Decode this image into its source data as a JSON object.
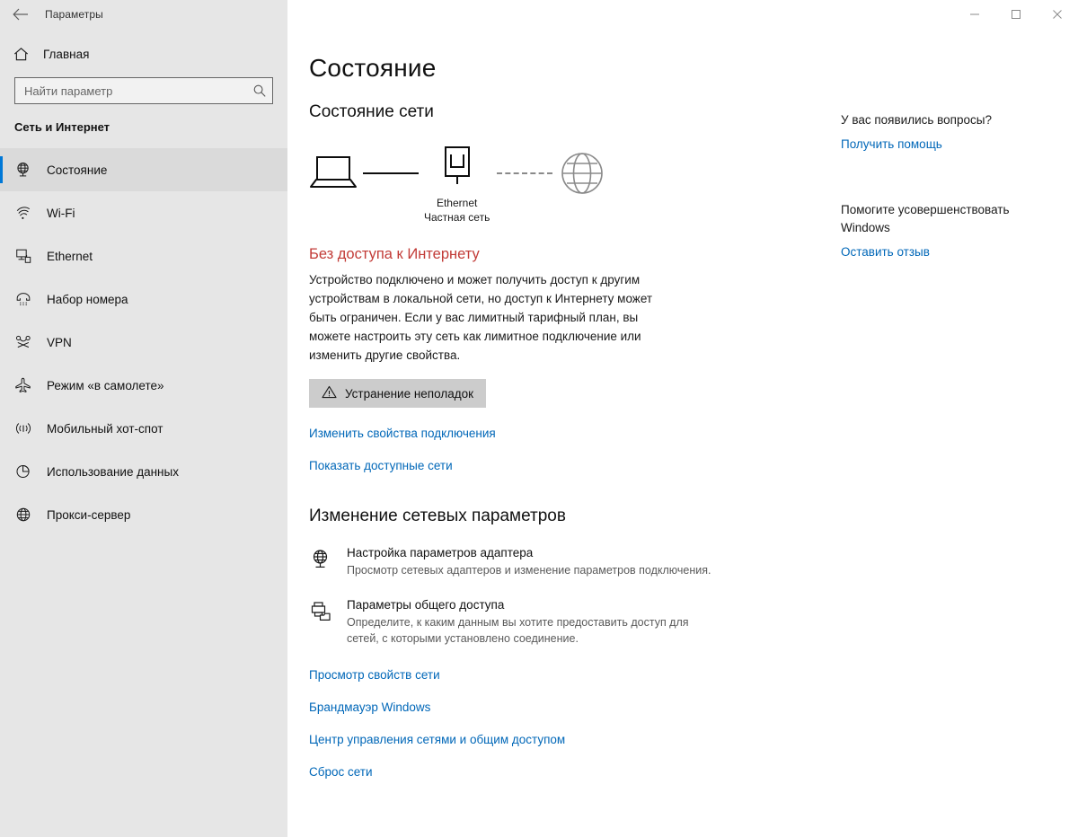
{
  "titlebar": {
    "back_icon": "back-arrow-icon",
    "title": "Параметры",
    "minimize_icon": "minimize-icon",
    "maximize_icon": "maximize-icon",
    "close_icon": "close-icon"
  },
  "sidebar": {
    "home": {
      "icon": "home-icon",
      "label": "Главная"
    },
    "search": {
      "icon": "search-icon",
      "placeholder": "Найти параметр",
      "value": ""
    },
    "section_title": "Сеть и Интернет",
    "items": [
      {
        "icon": "globe-monitor-icon",
        "label": "Состояние",
        "selected": true
      },
      {
        "icon": "wifi-icon",
        "label": "Wi-Fi",
        "selected": false
      },
      {
        "icon": "ethernet-icon",
        "label": "Ethernet",
        "selected": false
      },
      {
        "icon": "dialup-icon",
        "label": "Набор номера",
        "selected": false
      },
      {
        "icon": "vpn-icon",
        "label": "VPN",
        "selected": false
      },
      {
        "icon": "airplane-icon",
        "label": "Режим «в самолете»",
        "selected": false
      },
      {
        "icon": "hotspot-icon",
        "label": "Мобильный хот-спот",
        "selected": false
      },
      {
        "icon": "data-usage-icon",
        "label": "Использование данных",
        "selected": false
      },
      {
        "icon": "proxy-globe-icon",
        "label": "Прокси-сервер",
        "selected": false
      }
    ]
  },
  "main": {
    "page_title": "Состояние",
    "network_status_heading": "Состояние сети",
    "diagram": {
      "device_icon": "laptop-icon",
      "adapter_icon": "ethernet-port-icon",
      "adapter_name": "Ethernet",
      "adapter_network_type": "Частная сеть",
      "internet_icon": "globe-icon",
      "device_to_adapter_link": "connected",
      "adapter_to_internet_link": "disconnected"
    },
    "status_heading": "Без доступа к Интернету",
    "status_description": "Устройство подключено и может получить доступ к другим устройствам в локальной сети, но доступ к Интернету может быть ограничен. Если у вас лимитный тарифный план, вы можете настроить эту сеть как лимитное подключение или изменить другие свойства.",
    "troubleshoot_button": {
      "icon": "warning-triangle-icon",
      "label": "Устранение неполадок"
    },
    "links_top": [
      "Изменить свойства подключения",
      "Показать доступные сети"
    ],
    "change_settings_heading": "Изменение сетевых параметров",
    "settings": [
      {
        "icon": "adapter-globe-icon",
        "title": "Настройка параметров адаптера",
        "subtitle": "Просмотр сетевых адаптеров и изменение параметров подключения."
      },
      {
        "icon": "sharing-printer-folder-icon",
        "title": "Параметры общего доступа",
        "subtitle": "Определите, к каким данным вы хотите предоставить доступ для сетей, с которыми установлено соединение."
      }
    ],
    "links_bottom": [
      "Просмотр свойств сети",
      "Брандмауэр Windows",
      "Центр управления сетями и общим доступом",
      "Сброс сети"
    ]
  },
  "right_panel": {
    "blocks": [
      {
        "title": "У вас появились вопросы?",
        "link": "Получить помощь"
      },
      {
        "title": "Помогите усовершенствовать Windows",
        "link": "Оставить отзыв"
      }
    ]
  },
  "colors": {
    "accent": "#0078d7",
    "link": "#0067b8",
    "error": "#c23b37",
    "sidebar_bg": "#e6e6e6",
    "button_bg": "#cccccc"
  }
}
